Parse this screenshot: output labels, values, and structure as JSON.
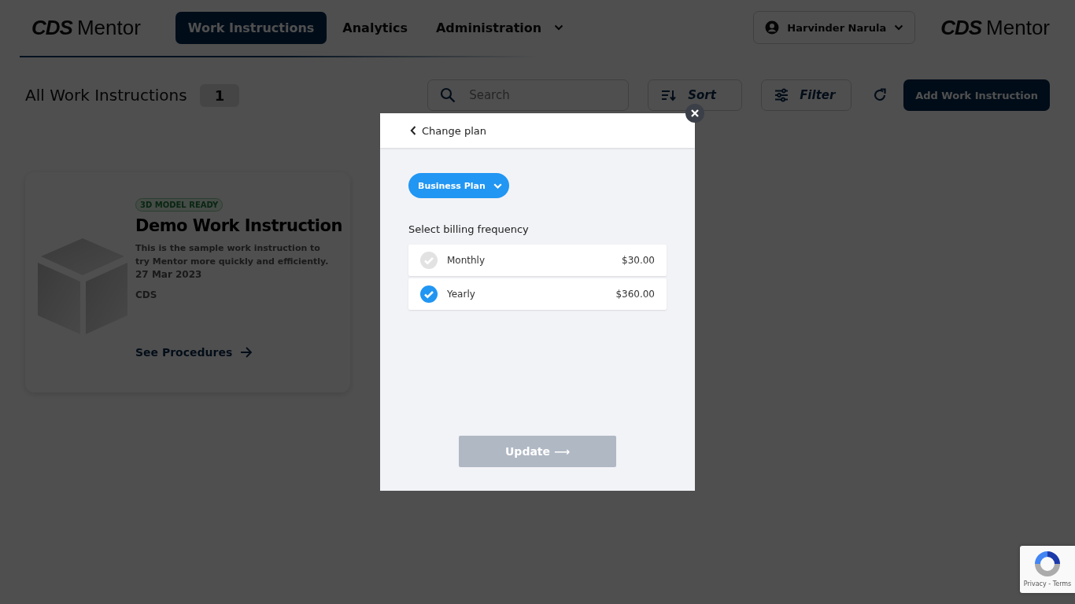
{
  "header": {
    "logo": {
      "mark": "CDS",
      "name": "Mentor"
    },
    "nav": [
      {
        "label": "Work Instructions",
        "selected": true,
        "dropdown": false
      },
      {
        "label": "Analytics",
        "selected": false,
        "dropdown": false
      },
      {
        "label": "Administration",
        "selected": false,
        "dropdown": true
      }
    ],
    "user": "Harvinder Narula",
    "right_logo": {
      "mark": "CDS",
      "name": "Mentor"
    }
  },
  "toolbar": {
    "title": "All Work Instructions",
    "count": "1",
    "search": {
      "placeholder": "Search"
    },
    "sort": "Sort",
    "filter": "Filter",
    "add": "Add Work Instruction"
  },
  "cards": [
    {
      "badge": "3D MODEL READY",
      "title": "Demo Work Instruction",
      "description": "This is the sample work instruction to try Mentor more quickly and efficiently.",
      "date": "27 Mar 2023",
      "owner": "CDS",
      "link": "See Procedures"
    }
  ],
  "modal": {
    "title": "Change plan",
    "plan": "Business Plan",
    "prompt": "Select billing frequency",
    "options": [
      {
        "label": "Monthly",
        "price": "$30.00",
        "selected": false
      },
      {
        "label": "Yearly",
        "price": "$360.00",
        "selected": true
      }
    ],
    "button": {
      "label": "Update ⟶",
      "disabled": true
    }
  },
  "recaptcha": {
    "links": "Privacy - Terms"
  }
}
